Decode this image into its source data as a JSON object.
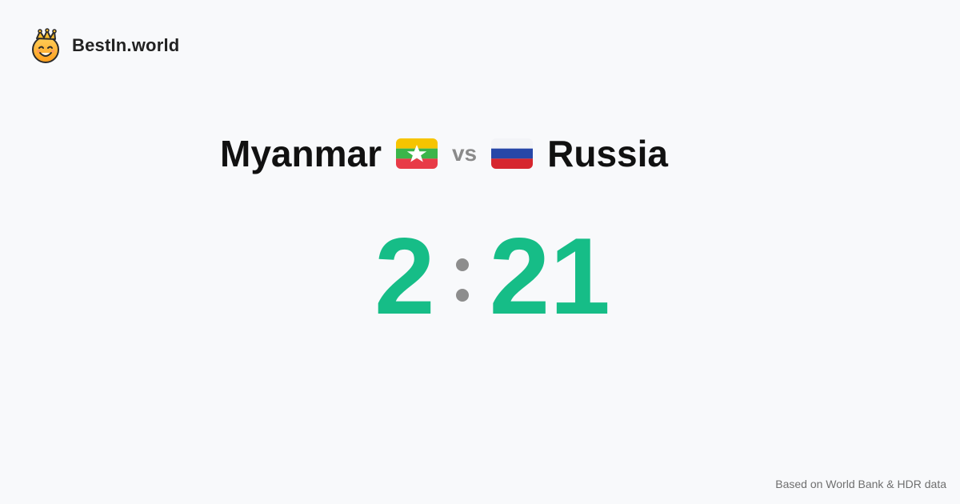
{
  "brand": {
    "name": "BestIn.world",
    "logo_icon": "crown-smile-icon"
  },
  "comparison": {
    "left_country": {
      "name": "Myanmar",
      "flag_icon": "myanmar-flag-icon"
    },
    "separator_text": "vs",
    "right_country": {
      "name": "Russia",
      "flag_icon": "russia-flag-icon"
    }
  },
  "score": {
    "left": "2",
    "right": "21"
  },
  "footer": {
    "source_note": "Based on World Bank & HDR data"
  },
  "colors": {
    "background": "#f8f9fb",
    "score": "#16bd87",
    "muted": "#8a8a8a",
    "text": "#111111"
  }
}
